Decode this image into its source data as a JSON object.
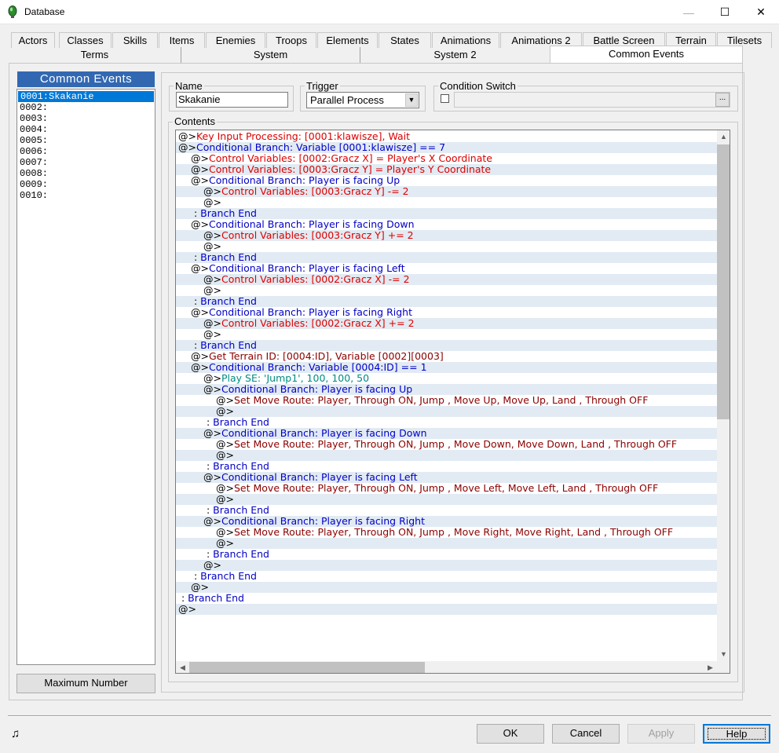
{
  "window": {
    "title": "Database",
    "minimize": "—",
    "maximize": "☐",
    "close": "✕"
  },
  "tabs_row1": [
    "Actors",
    "Classes",
    "Skills",
    "Items",
    "Enemies",
    "Troops",
    "Elements",
    "States",
    "Animations",
    "Animations 2",
    "Battle Screen",
    "Terrain",
    "Tilesets"
  ],
  "tabs_row2": [
    "Terms",
    "System",
    "System 2",
    "Common Events"
  ],
  "left": {
    "header": "Common Events",
    "items": [
      "0001:Skakanie",
      "0002:",
      "0003:",
      "0004:",
      "0005:",
      "0006:",
      "0007:",
      "0008:",
      "0009:",
      "0010:"
    ],
    "selected_index": 0,
    "max_button": "Maximum Number"
  },
  "form": {
    "name_label": "Name",
    "name_value": "Skakanie",
    "trigger_label": "Trigger",
    "trigger_value": "Parallel Process",
    "condition_label": "Condition Switch",
    "condition_button": "...",
    "contents_label": "Contents"
  },
  "contents": [
    {
      "indent": 0,
      "prefix": "@>",
      "text": "Key Input Processing: [0001:klawisze], Wait",
      "color": "red"
    },
    {
      "indent": 0,
      "prefix": "@>",
      "text": "Conditional Branch: Variable [0001:klawisze] == 7",
      "color": "blue"
    },
    {
      "indent": 1,
      "prefix": "@>",
      "text": "Control Variables: [0002:Gracz X] = Player's X Coordinate",
      "color": "red"
    },
    {
      "indent": 1,
      "prefix": "@>",
      "text": "Control Variables: [0003:Gracz Y] = Player's Y Coordinate",
      "color": "red"
    },
    {
      "indent": 1,
      "prefix": "@>",
      "text": "Conditional Branch: Player is facing Up",
      "color": "blue"
    },
    {
      "indent": 2,
      "prefix": "@>",
      "text": "Control Variables: [0003:Gracz Y] -= 2",
      "color": "red"
    },
    {
      "indent": 2,
      "prefix": "@>",
      "text": "",
      "color": "black"
    },
    {
      "indent": 1,
      "prefix": " : ",
      "text": "Branch End",
      "color": "blue"
    },
    {
      "indent": 1,
      "prefix": "@>",
      "text": "Conditional Branch: Player is facing Down",
      "color": "blue"
    },
    {
      "indent": 2,
      "prefix": "@>",
      "text": "Control Variables: [0003:Gracz Y] += 2",
      "color": "red"
    },
    {
      "indent": 2,
      "prefix": "@>",
      "text": "",
      "color": "black"
    },
    {
      "indent": 1,
      "prefix": " : ",
      "text": "Branch End",
      "color": "blue"
    },
    {
      "indent": 1,
      "prefix": "@>",
      "text": "Conditional Branch: Player is facing Left",
      "color": "blue"
    },
    {
      "indent": 2,
      "prefix": "@>",
      "text": "Control Variables: [0002:Gracz X] -= 2",
      "color": "red"
    },
    {
      "indent": 2,
      "prefix": "@>",
      "text": "",
      "color": "black"
    },
    {
      "indent": 1,
      "prefix": " : ",
      "text": "Branch End",
      "color": "blue"
    },
    {
      "indent": 1,
      "prefix": "@>",
      "text": "Conditional Branch: Player is facing Right",
      "color": "blue"
    },
    {
      "indent": 2,
      "prefix": "@>",
      "text": "Control Variables: [0002:Gracz X] += 2",
      "color": "red"
    },
    {
      "indent": 2,
      "prefix": "@>",
      "text": "",
      "color": "black"
    },
    {
      "indent": 1,
      "prefix": " : ",
      "text": "Branch End",
      "color": "blue"
    },
    {
      "indent": 1,
      "prefix": "@>",
      "text": "Get Terrain ID: [0004:ID], Variable [0002][0003]",
      "color": "darkred"
    },
    {
      "indent": 1,
      "prefix": "@>",
      "text": "Conditional Branch: Variable [0004:ID] == 1",
      "color": "blue"
    },
    {
      "indent": 2,
      "prefix": "@>",
      "text": "Play SE: 'Jump1', 100, 100, 50",
      "color": "teal"
    },
    {
      "indent": 2,
      "prefix": "@>",
      "text": "Conditional Branch: Player is facing Up",
      "color": "blue"
    },
    {
      "indent": 3,
      "prefix": "@>",
      "text": "Set Move Route: Player, Through ON, Jump , Move Up, Move Up, Land , Through OFF",
      "color": "darkred"
    },
    {
      "indent": 3,
      "prefix": "@>",
      "text": "",
      "color": "black"
    },
    {
      "indent": 2,
      "prefix": " : ",
      "text": "Branch End",
      "color": "blue"
    },
    {
      "indent": 2,
      "prefix": "@>",
      "text": "Conditional Branch: Player is facing Down",
      "color": "blue"
    },
    {
      "indent": 3,
      "prefix": "@>",
      "text": "Set Move Route: Player, Through ON, Jump , Move Down, Move Down, Land , Through OFF",
      "color": "darkred"
    },
    {
      "indent": 3,
      "prefix": "@>",
      "text": "",
      "color": "black"
    },
    {
      "indent": 2,
      "prefix": " : ",
      "text": "Branch End",
      "color": "blue"
    },
    {
      "indent": 2,
      "prefix": "@>",
      "text": "Conditional Branch: Player is facing Left",
      "color": "blue"
    },
    {
      "indent": 3,
      "prefix": "@>",
      "text": "Set Move Route: Player, Through ON, Jump , Move Left, Move Left, Land , Through OFF",
      "color": "darkred"
    },
    {
      "indent": 3,
      "prefix": "@>",
      "text": "",
      "color": "black"
    },
    {
      "indent": 2,
      "prefix": " : ",
      "text": "Branch End",
      "color": "blue"
    },
    {
      "indent": 2,
      "prefix": "@>",
      "text": "Conditional Branch: Player is facing Right",
      "color": "blue"
    },
    {
      "indent": 3,
      "prefix": "@>",
      "text": "Set Move Route: Player, Through ON, Jump , Move Right, Move Right, Land , Through OFF",
      "color": "darkred"
    },
    {
      "indent": 3,
      "prefix": "@>",
      "text": "",
      "color": "black"
    },
    {
      "indent": 2,
      "prefix": " : ",
      "text": "Branch End",
      "color": "blue"
    },
    {
      "indent": 2,
      "prefix": "@>",
      "text": "",
      "color": "black"
    },
    {
      "indent": 1,
      "prefix": " : ",
      "text": "Branch End",
      "color": "blue"
    },
    {
      "indent": 1,
      "prefix": "@>",
      "text": "",
      "color": "black"
    },
    {
      "indent": 0,
      "prefix": " : ",
      "text": "Branch End",
      "color": "blue"
    },
    {
      "indent": 0,
      "prefix": "@>",
      "text": "",
      "color": "black"
    }
  ],
  "colors": {
    "red": "#dc0000",
    "blue": "#0000c8",
    "darkred": "#8c0000",
    "teal": "#008c82",
    "black": "#000000",
    "selection": "#0078d7",
    "header": "#3268b2"
  },
  "buttons": {
    "ok": "OK",
    "cancel": "Cancel",
    "apply": "Apply",
    "help": "Help"
  },
  "status_icon": "music-note-icon"
}
